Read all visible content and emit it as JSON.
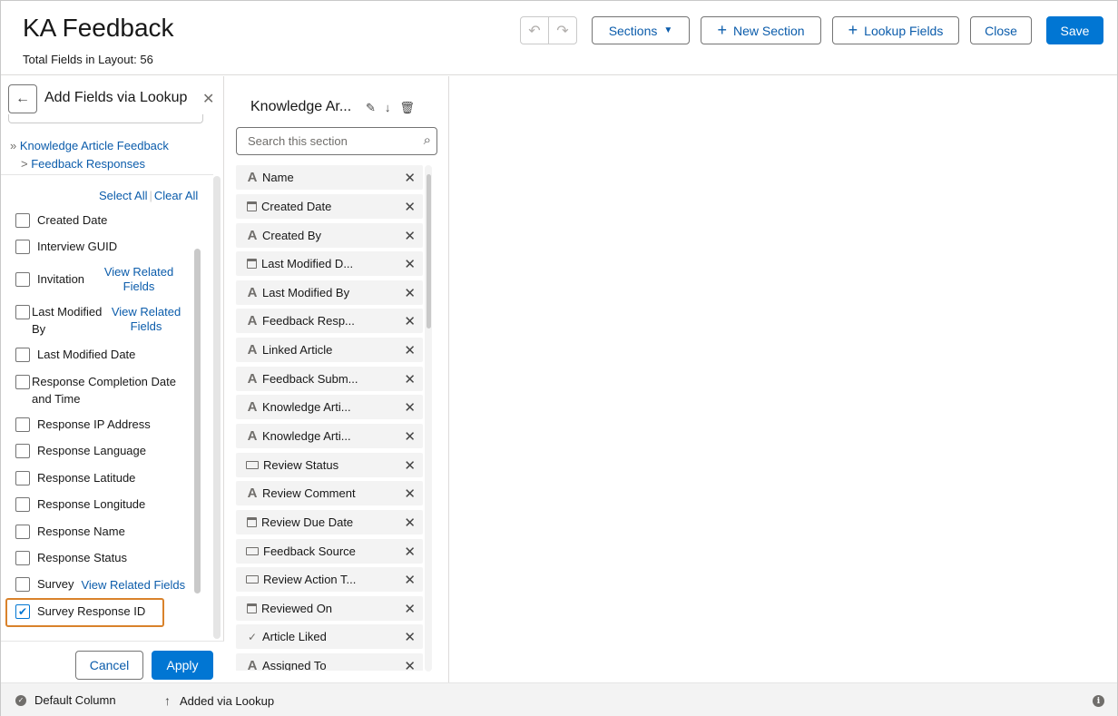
{
  "header": {
    "title": "KA Feedback",
    "subtitle": "Total Fields in Layout: 56",
    "undo_icon": "undo-icon",
    "redo_icon": "redo-icon",
    "sections_label": "Sections",
    "new_section_label": "New Section",
    "lookup_fields_label": "Lookup Fields",
    "close_label": "Close",
    "save_label": "Save"
  },
  "lookup_panel": {
    "title": "Add Fields via Lookup",
    "breadcrumb_root": "Knowledge Article Feedback",
    "breadcrumb_child": "Feedback Responses",
    "select_all": "Select All",
    "clear_all": "Clear All",
    "view_related": "View Related Fields",
    "fields": [
      {
        "label": "Created Date",
        "checked": false
      },
      {
        "label": "Interview GUID",
        "checked": false
      },
      {
        "label": "Invitation",
        "checked": false,
        "view_related": true
      },
      {
        "label": "Last Modified By",
        "checked": false,
        "view_related": true
      },
      {
        "label": "Last Modified Date",
        "checked": false
      },
      {
        "label": "Response Completion Date and Time",
        "checked": false
      },
      {
        "label": "Response IP Address",
        "checked": false
      },
      {
        "label": "Response Language",
        "checked": false
      },
      {
        "label": "Response Latitude",
        "checked": false
      },
      {
        "label": "Response Longitude",
        "checked": false
      },
      {
        "label": "Response Name",
        "checked": false
      },
      {
        "label": "Response Status",
        "checked": false
      },
      {
        "label": "Survey",
        "checked": false,
        "view_related": true
      },
      {
        "label": "Survey Response ID",
        "checked": true
      }
    ],
    "cancel_label": "Cancel",
    "apply_label": "Apply",
    "highlight_color": "#d9822b"
  },
  "section": {
    "title": "Knowledge Ar...",
    "search_placeholder": "Search this section",
    "fields": [
      {
        "label": "Name",
        "icon": "text"
      },
      {
        "label": "Created Date",
        "icon": "calendar"
      },
      {
        "label": "Created By",
        "icon": "text"
      },
      {
        "label": "Last Modified D...",
        "icon": "calendar"
      },
      {
        "label": "Last Modified By",
        "icon": "text"
      },
      {
        "label": "Feedback Resp...",
        "icon": "text"
      },
      {
        "label": "Linked Article",
        "icon": "text"
      },
      {
        "label": "Feedback Subm...",
        "icon": "text"
      },
      {
        "label": "Knowledge Arti...",
        "icon": "text"
      },
      {
        "label": "Knowledge Arti...",
        "icon": "text"
      },
      {
        "label": "Review Status",
        "icon": "picklist"
      },
      {
        "label": "Review Comment",
        "icon": "text"
      },
      {
        "label": "Review Due Date",
        "icon": "calendar"
      },
      {
        "label": "Feedback Source",
        "icon": "picklist"
      },
      {
        "label": "Review Action T...",
        "icon": "picklist"
      },
      {
        "label": "Reviewed On",
        "icon": "calendar"
      },
      {
        "label": "Article Liked",
        "icon": "checkbox"
      },
      {
        "label": "Assigned To",
        "icon": "text"
      }
    ]
  },
  "footer": {
    "default_column": "Default Column",
    "added_via_lookup": "Added via Lookup"
  },
  "colors": {
    "brand": "#0176d3",
    "link": "#0b5cab"
  }
}
